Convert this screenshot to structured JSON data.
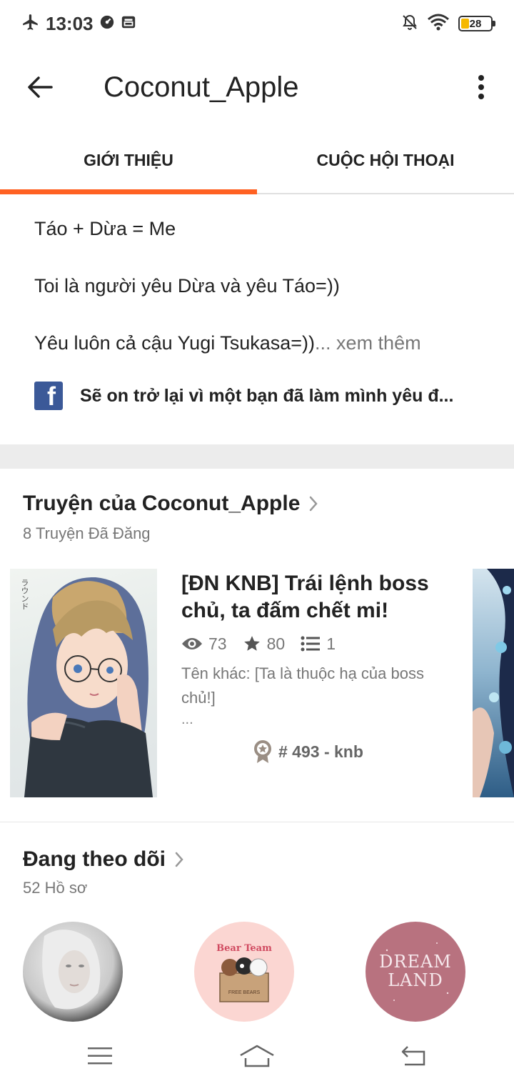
{
  "status_bar": {
    "time": "13:03",
    "battery": "28",
    "battery_level": 0.28,
    "icons": [
      "airplane-icon",
      "data-saver-icon",
      "notification-icon",
      "mute-icon",
      "wifi-icon",
      "battery-icon"
    ]
  },
  "app_bar": {
    "title": "Coconut_Apple"
  },
  "tabs": [
    {
      "label": "GIỚI THIỆU",
      "active": true
    },
    {
      "label": "CUỘC HỘI THOẠI",
      "active": false
    }
  ],
  "about": {
    "lines": [
      "Táo + Dừa = Me",
      "Toi là người yêu Dừa và yêu Táo=))",
      "Yêu luôn cả cậu Yugi Tsukasa=))"
    ],
    "ellipsis": "...",
    "see_more": " xem thêm",
    "facebook_text": "Sẽ on trở lại vì một bạn đã làm mình yêu đ..."
  },
  "stories": {
    "title": "Truyện của Coconut_Apple",
    "subtitle": "8 Truyện Đã Đăng",
    "items": [
      {
        "title": "[ĐN KNB] Trái lệnh boss chủ, ta đấm chết mi!",
        "views": "73",
        "votes": "80",
        "parts": "1",
        "description": "Tên khác: [Ta là thuộc hạ của boss chủ!]",
        "more": "...",
        "rank": "# 493 - knb",
        "cover_text": "ラウンド"
      }
    ]
  },
  "following": {
    "title": "Đang theo dõi",
    "subtitle": "52 Hồ sơ",
    "avatars": [
      {
        "text": ""
      },
      {
        "text": "Bear Team",
        "sub": "FREE BEARS"
      },
      {
        "text": "DREAM",
        "sub": "LAND"
      }
    ]
  },
  "accent_color": "#ff6122"
}
